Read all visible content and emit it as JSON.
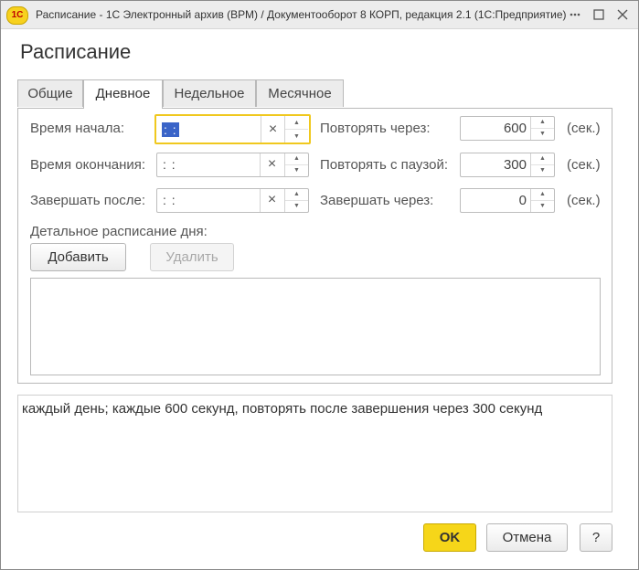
{
  "window": {
    "logo": "1С",
    "title": "Расписание - 1С Электронный архив (ВРМ) / Документооборот 8 КОРП, редакция 2.1  (1С:Предприятие)",
    "controls": [
      "more-icon",
      "maximize-icon",
      "close-icon"
    ]
  },
  "form": {
    "title": "Расписание"
  },
  "tabs": [
    {
      "label": "Общие",
      "active": false
    },
    {
      "label": "Дневное",
      "active": true
    },
    {
      "label": "Недельное",
      "active": false
    },
    {
      "label": "Месячное",
      "active": false
    }
  ],
  "fields": {
    "start_time": {
      "label": "Время начала:",
      "value": " :  : "
    },
    "end_time": {
      "label": "Время окончания:",
      "value": " :  : "
    },
    "finish_after": {
      "label": "Завершать после:",
      "value": " :  : "
    },
    "repeat_every": {
      "label": "Повторять через:",
      "value": "600",
      "unit": "(сек.)"
    },
    "repeat_pause": {
      "label": "Повторять с паузой:",
      "value": "300",
      "unit": "(сек.)"
    },
    "finish_in": {
      "label": "Завершать через:",
      "value": "0",
      "unit": "(сек.)"
    },
    "clear_glyph": "×",
    "spin_up_glyph": "▲",
    "spin_down_glyph": "▼"
  },
  "detailed": {
    "label": "Детальное расписание дня:",
    "add_button": "Добавить",
    "delete_button": "Удалить",
    "rows": []
  },
  "summary": {
    "text": "каждый день; каждые 600 секунд, повторять после завершения через 300 секунд"
  },
  "footer": {
    "ok": "OK",
    "cancel": "Отмена",
    "help": "?"
  },
  "colors": {
    "accent_yellow": "#f6d619",
    "focus_border": "#f0c81e",
    "selection": "#3a64c8"
  }
}
